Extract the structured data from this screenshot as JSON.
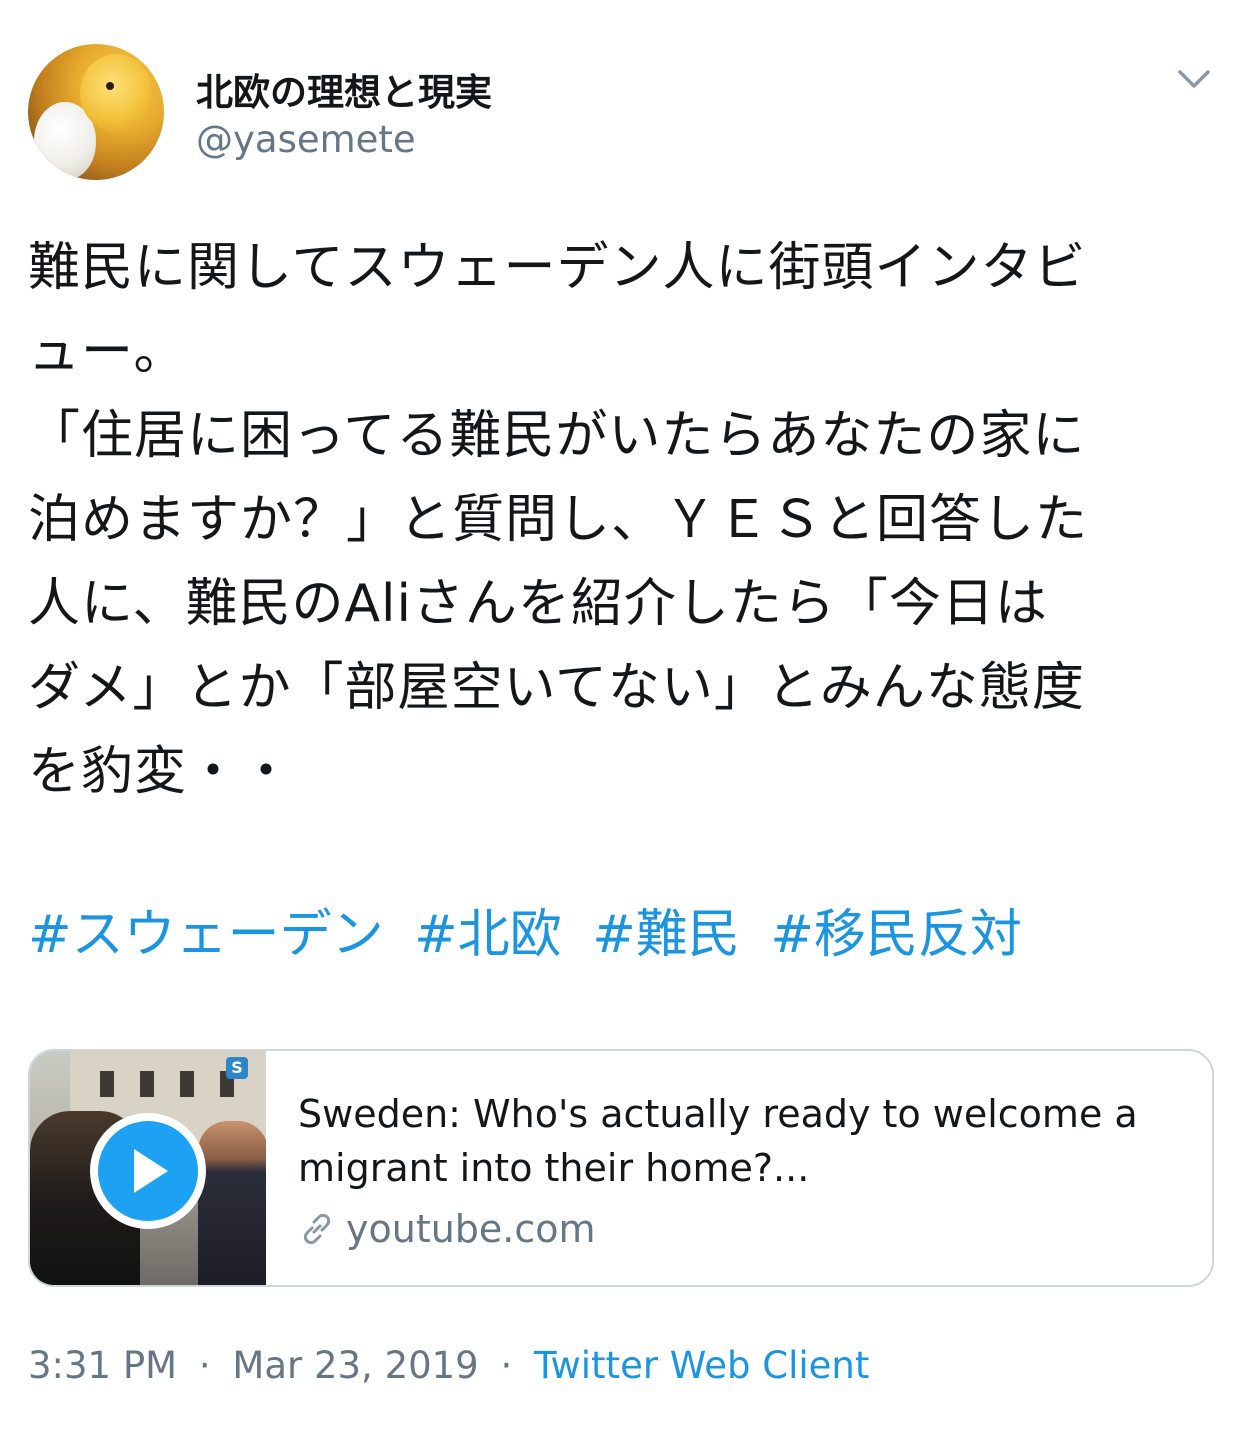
{
  "user": {
    "display_name": "北欧の理想と現実",
    "handle": "@yasemete",
    "avatar_icon": "chick-with-egg-avatar"
  },
  "tweet": {
    "text_lines": [
      "難民に関してスウェーデン人に街頭インタビ",
      "ュー。",
      "「住居に困ってる難民がいたらあなたの家に",
      "泊めますか？」と質問し、ＹＥＳと回答した",
      "人に、難民のAliさんを紹介したら「今日は",
      "ダメ」とか「部屋空いてない」とみんな態度",
      "を豹変・・"
    ],
    "hashtags": [
      "#スウェーデン",
      "#北欧",
      "#難民",
      "#移民反対"
    ]
  },
  "card": {
    "title_lines": [
      "Sweden: Who's actually ready to welcome a",
      "migrant into their home?..."
    ],
    "domain": "youtube.com",
    "thumbnail_logo": "S",
    "play_icon": "play-icon",
    "link_icon": "link-icon"
  },
  "footer": {
    "time": "3:31 PM",
    "separator": "·",
    "date": "Mar 23, 2019",
    "source": "Twitter Web Client"
  },
  "colors": {
    "link": "#1b95e0",
    "secondary_text": "#657786",
    "border": "#ccd6dd",
    "play": "#1da1f2"
  }
}
